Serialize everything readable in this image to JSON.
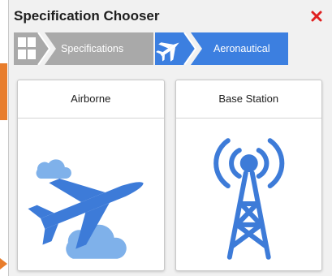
{
  "dialog": {
    "title": "Specification Chooser",
    "close_icon": "close-icon"
  },
  "breadcrumb": {
    "items": [
      {
        "label": "Specifications",
        "icon": "grid-icon",
        "state": "inactive"
      },
      {
        "label": "Aeronautical",
        "icon": "airplane-icon",
        "state": "active"
      }
    ]
  },
  "options": [
    {
      "label": "Airborne",
      "icon": "airplane-cloud-icon"
    },
    {
      "label": "Base Station",
      "icon": "radio-tower-icon"
    }
  ],
  "colors": {
    "accent_blue": "#3c7fe0",
    "icon_blue": "#3d7bd8",
    "cloud_blue": "#7fb1ea",
    "inactive_grey": "#a9a9a9",
    "close_red": "#e02020",
    "side_orange": "#e87d2c"
  }
}
